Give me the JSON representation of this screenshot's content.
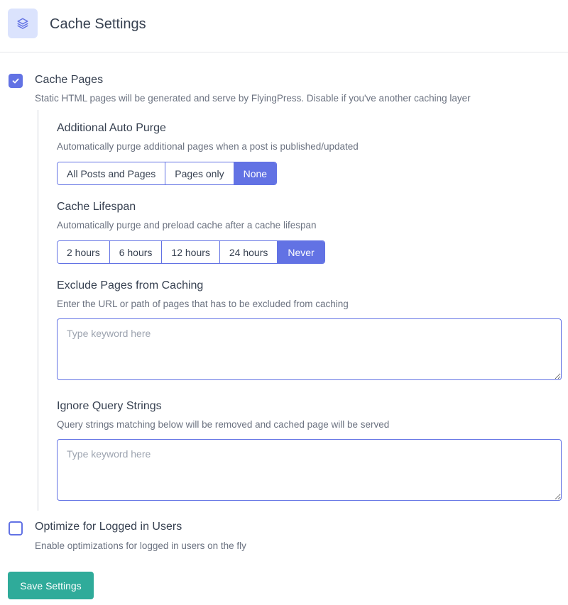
{
  "header": {
    "title": "Cache Settings",
    "icon": "layers-icon"
  },
  "cache_pages": {
    "checked": true,
    "label": "Cache Pages",
    "description": "Static HTML pages will be generated and serve by FlyingPress. Disable if you've another caching layer"
  },
  "auto_purge": {
    "label": "Additional Auto Purge",
    "description": "Automatically purge additional pages when a post is published/updated",
    "options": [
      "All Posts and Pages",
      "Pages only",
      "None"
    ],
    "selected": "None"
  },
  "lifespan": {
    "label": "Cache Lifespan",
    "description": "Automatically purge and preload cache after a cache lifespan",
    "options": [
      "2 hours",
      "6 hours",
      "12 hours",
      "24 hours",
      "Never"
    ],
    "selected": "Never"
  },
  "exclude_pages": {
    "label": "Exclude Pages from Caching",
    "description": "Enter the URL or path of pages that has to be excluded from caching",
    "placeholder": "Type keyword here",
    "value": ""
  },
  "ignore_query": {
    "label": "Ignore Query Strings",
    "description": "Query strings matching below will be removed and cached page will be served",
    "placeholder": "Type keyword here",
    "value": ""
  },
  "logged_in": {
    "checked": false,
    "label": "Optimize for Logged in Users",
    "description": "Enable optimizations for logged in users on the fly"
  },
  "save_button": {
    "label": "Save Settings"
  },
  "colors": {
    "accent": "#6272e4",
    "save": "#2fab9a",
    "icon_bg": "#dbe3fd"
  }
}
